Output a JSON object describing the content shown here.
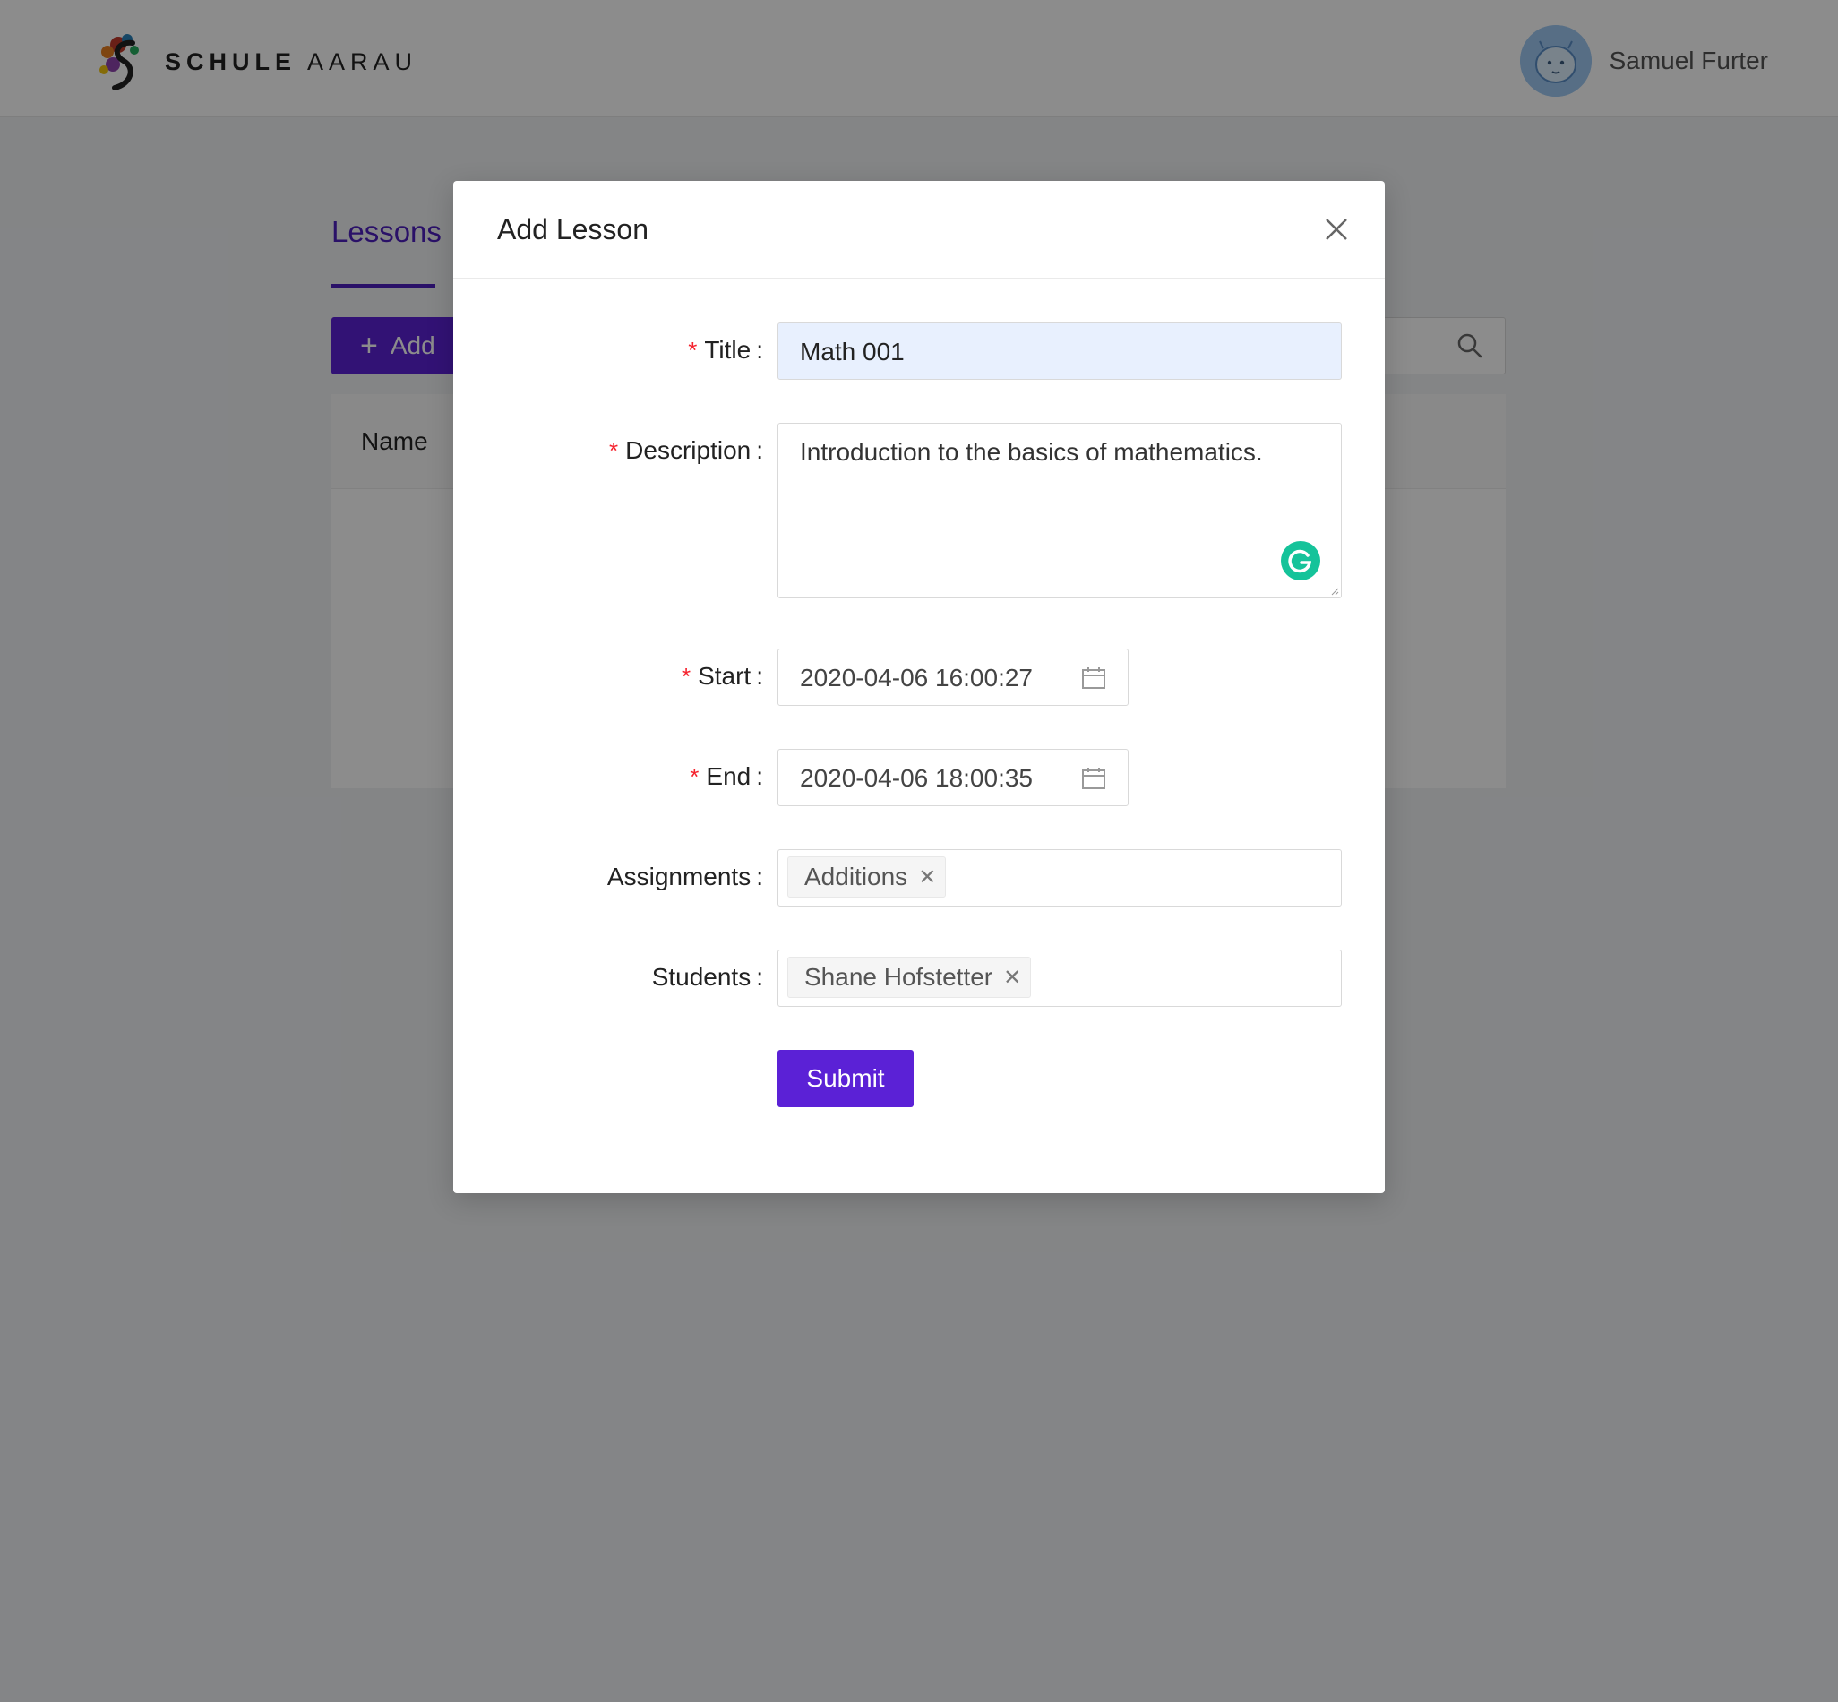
{
  "header": {
    "brand_bold": "SCHULE",
    "brand_light": "AARAU",
    "user_name": "Samuel Furter"
  },
  "page": {
    "tab_label": "Lessons",
    "add_button": "Add",
    "table_column_name": "Name"
  },
  "modal": {
    "title": "Add Lesson",
    "fields": {
      "title": {
        "label": "Title",
        "required": true,
        "value": "Math 001"
      },
      "description": {
        "label": "Description",
        "required": true,
        "value": "Introduction to the basics of mathematics."
      },
      "start": {
        "label": "Start",
        "required": true,
        "value": "2020-04-06 16:00:27"
      },
      "end": {
        "label": "End",
        "required": true,
        "value": "2020-04-06 18:00:35"
      },
      "assignments": {
        "label": "Assignments",
        "tags": [
          "Additions"
        ]
      },
      "students": {
        "label": "Students",
        "tags": [
          "Shane Hofstetter"
        ]
      }
    },
    "submit_label": "Submit"
  },
  "colors": {
    "primary": "#5b21d6",
    "required_mark": "#f5222d",
    "autofill_bg": "#e8f0fe",
    "grammarly": "#15c39a"
  }
}
